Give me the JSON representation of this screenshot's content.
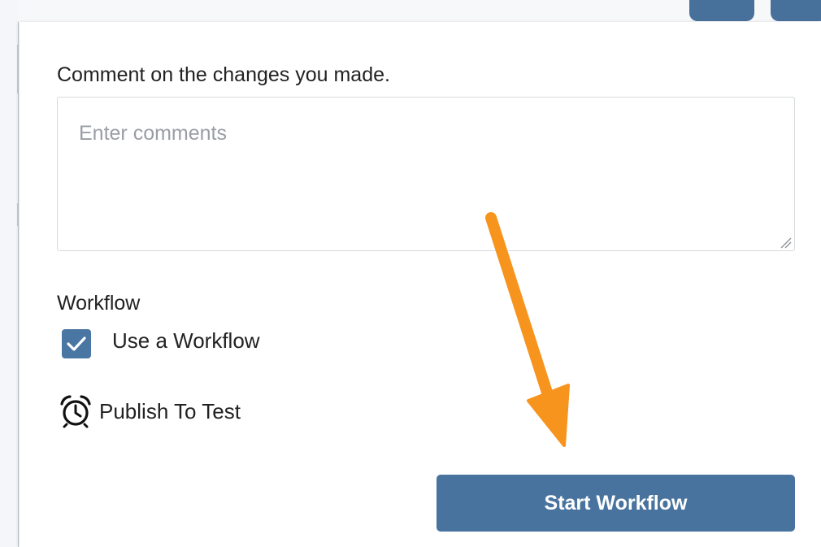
{
  "dialog": {
    "comment_label": "Comment on the changes you made.",
    "comments_placeholder": "Enter comments",
    "comments_value": "",
    "workflow_title": "Workflow",
    "use_workflow_label": "Use a Workflow",
    "use_workflow_checked": true,
    "publish_label": "Publish To Test",
    "publish_icon": "alarm-clock-icon",
    "start_button_label": "Start Workflow"
  },
  "colors": {
    "accent": "#48739e",
    "annotation_arrow": "#f7941d"
  }
}
